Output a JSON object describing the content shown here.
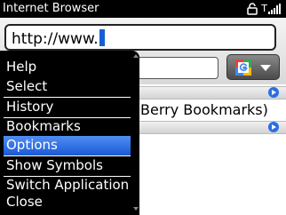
{
  "title_bar": {
    "title": "Internet Browser",
    "icons": [
      "lock-icon",
      "signal-icon"
    ],
    "signal_label": "T"
  },
  "address_bar": {
    "value": "http://www."
  },
  "search": {
    "engine_icon": "google-icon",
    "dropdown_icon": "chevron-down-icon"
  },
  "list": {
    "bookmark_item_visible_text": "Berry Bookmarks)",
    "goto_icon": "arrow-right-circle-icon"
  },
  "menu": {
    "items": [
      "Help",
      "Select",
      "History",
      "Bookmarks",
      "Options",
      "Show Symbols",
      "Switch Application",
      "Close"
    ],
    "selected": "Options"
  },
  "colors": {
    "title_bar_bg": "#000000",
    "menu_bg": "#000000",
    "selection": "#1f62dc",
    "cursor": "#1560d4",
    "goto_icon": "#2a6fe0"
  }
}
